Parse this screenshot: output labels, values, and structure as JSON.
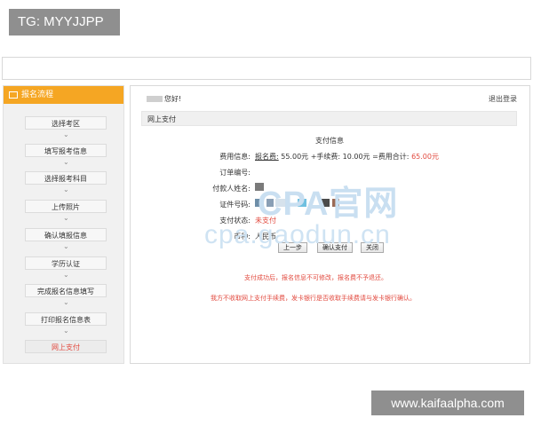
{
  "tag": "TG: MYYJJPP",
  "site_url": "www.kaifaalpha.com",
  "watermark": {
    "line1": "CPA官网",
    "line2": "cpa.gaodun.cn"
  },
  "sidebar": {
    "title": "报名流程",
    "steps": [
      {
        "label": "选择考区"
      },
      {
        "label": "填写报考信息"
      },
      {
        "label": "选择报考科目"
      },
      {
        "label": "上传照片"
      },
      {
        "label": "确认填报信息"
      },
      {
        "label": "学历认证"
      },
      {
        "label": "完成报名信息填写"
      },
      {
        "label": "打印报名信息表"
      },
      {
        "label": "网上支付"
      }
    ],
    "active_index": 8
  },
  "main": {
    "greeting": "您好!",
    "logout": "退出登录",
    "section": "网上支付",
    "info_title": "支付信息",
    "fee_label": "费用信息:",
    "fee_reg_label": "报名费:",
    "fee_reg_value": "55.00元",
    "fee_handling": "+手续费:",
    "fee_handling_value": "10.00元",
    "fee_total_label": "=费用合计:",
    "fee_total_value": "65.00元",
    "order_label": "订单编号:",
    "payer_label": "付款人姓名:",
    "id_label": "证件号码:",
    "status_label": "支付状态:",
    "status_value": "未支付",
    "currency_label": "币种:",
    "currency_value": "人民币",
    "buttons": {
      "prev": "上一步",
      "confirm": "确认支付",
      "close": "关闭"
    },
    "notice1": "支付成功后，报名信息不可修改，报名费不予退还。",
    "notice2": "我方不收取网上支付手续费，发卡银行是否收取手续费请与发卡银行确认。"
  },
  "colors": {
    "accent": "#f5a623",
    "alert": "#e24a3f"
  }
}
